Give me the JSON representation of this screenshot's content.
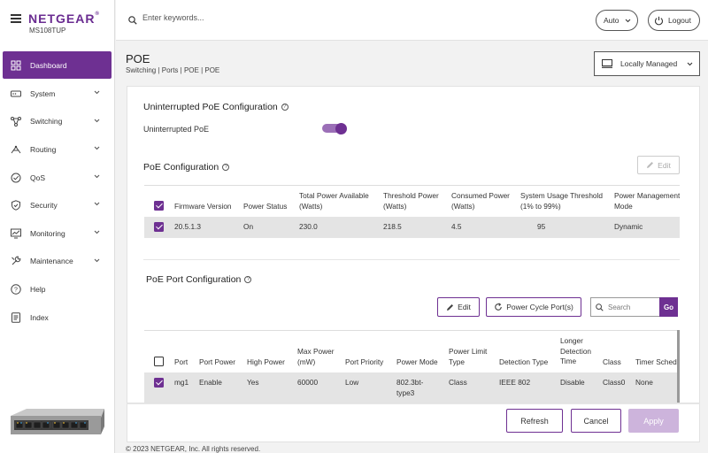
{
  "brand": {
    "logo": "NETGEAR",
    "model": "MS108TUP"
  },
  "sidebar": {
    "items": [
      {
        "label": "Dashboard",
        "icon": "dashboard-icon",
        "active": true
      },
      {
        "label": "System",
        "icon": "system-icon",
        "expandable": true
      },
      {
        "label": "Switching",
        "icon": "switching-icon",
        "expandable": true
      },
      {
        "label": "Routing",
        "icon": "routing-icon",
        "expandable": true
      },
      {
        "label": "QoS",
        "icon": "qos-icon",
        "expandable": true
      },
      {
        "label": "Security",
        "icon": "shield-icon",
        "expandable": true
      },
      {
        "label": "Monitoring",
        "icon": "monitoring-icon",
        "expandable": true
      },
      {
        "label": "Maintenance",
        "icon": "maintenance-icon",
        "expandable": true
      },
      {
        "label": "Help",
        "icon": "help-icon"
      },
      {
        "label": "Index",
        "icon": "index-icon"
      }
    ]
  },
  "topbar": {
    "search_placeholder": "Enter keywords...",
    "theme_label": "Auto",
    "logout_label": "Logout"
  },
  "page": {
    "title": "POE",
    "breadcrumb": "Switching | Ports | POE | POE",
    "management_mode": "Locally Managed"
  },
  "uninterrupted": {
    "title": "Uninterrupted PoE Configuration",
    "label": "Uninterrupted PoE",
    "enabled": true
  },
  "poe_config": {
    "title": "PoE Configuration",
    "edit_label": "Edit",
    "columns": [
      "Firmware Version",
      "Power Status",
      "Total Power Available\n(Watts)",
      "Threshold Power\n(Watts)",
      "Consumed Power\n(Watts)",
      "System Usage Threshold\n(1% to 99%)",
      "Power Management\nMode"
    ],
    "rows": [
      [
        "20.5.1.3",
        "On",
        "230.0",
        "218.5",
        "4.5",
        "95",
        "Dynamic"
      ]
    ]
  },
  "port_config": {
    "title": "PoE Port Configuration",
    "edit_label": "Edit",
    "power_cycle_label": "Power Cycle Port(s)",
    "search_placeholder": "Search",
    "go_label": "Go",
    "columns": [
      "Port",
      "Port Power",
      "High Power",
      "Max Power\n(mW)",
      "Port Priority",
      "Power Mode",
      "Power Limit\nType",
      "Detection Type",
      "Longer\nDetection\nTime",
      "Class",
      "Timer Schedule"
    ],
    "rows": [
      [
        "mg1",
        "Enable",
        "Yes",
        "60000",
        "Low",
        "802.3bt-\ntype3",
        "Class",
        "IEEE 802",
        "Disable",
        "Class0",
        "None"
      ]
    ]
  },
  "footer": {
    "refresh_label": "Refresh",
    "cancel_label": "Cancel",
    "apply_label": "Apply",
    "copyright": "© 2023 NETGEAR, Inc. All rights reserved."
  },
  "colors": {
    "accent": "#6e3092",
    "accent_light": "#9b6fb7",
    "apply_disabled": "#cdb4dc",
    "row_selected": "#e4e4e4"
  }
}
